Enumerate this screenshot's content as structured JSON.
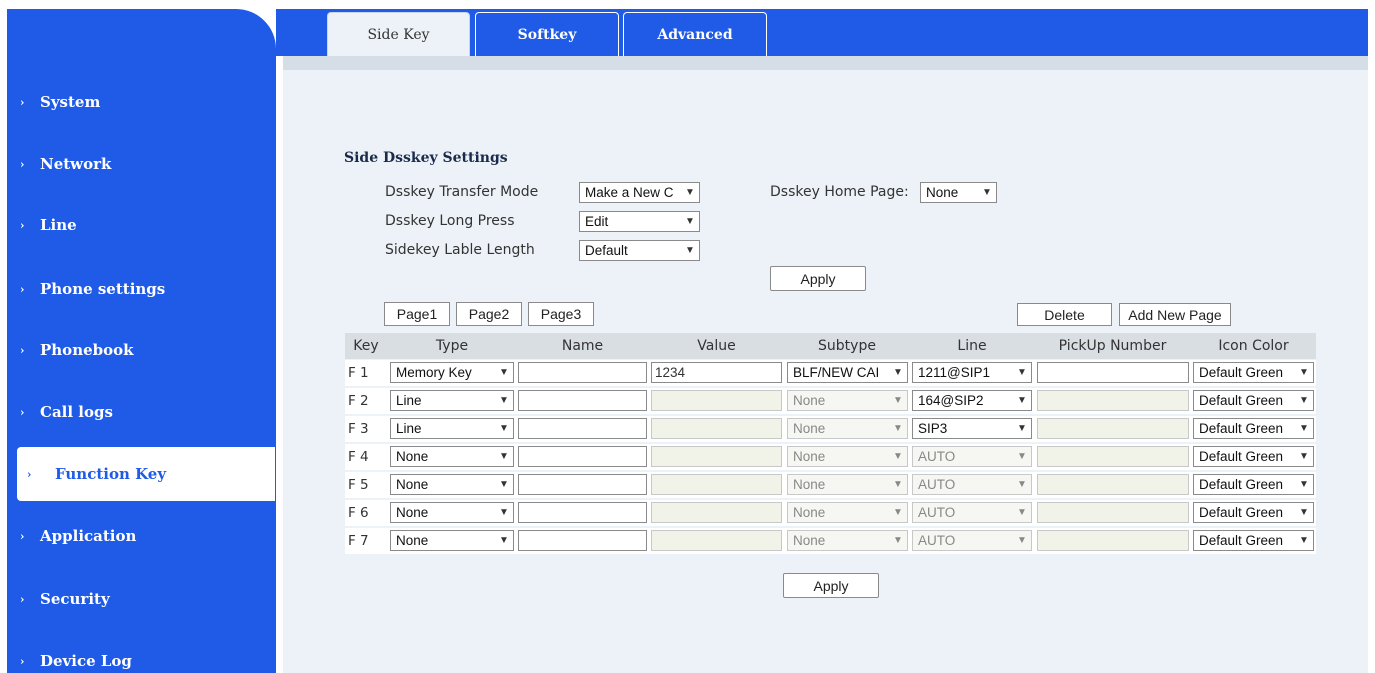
{
  "sidebar": {
    "items": [
      {
        "label": "System"
      },
      {
        "label": "Network"
      },
      {
        "label": "Line"
      },
      {
        "label": "Phone settings"
      },
      {
        "label": "Phonebook"
      },
      {
        "label": "Call logs"
      },
      {
        "label": "Function Key",
        "active": true
      },
      {
        "label": "Application"
      },
      {
        "label": "Security"
      },
      {
        "label": "Device Log"
      }
    ]
  },
  "tabs": [
    {
      "label": "Side Key",
      "active": true
    },
    {
      "label": "Softkey"
    },
    {
      "label": "Advanced"
    }
  ],
  "settings": {
    "title": "Side Dsskey Settings",
    "transfer_mode_label": "Dsskey Transfer Mode",
    "transfer_mode_value": "Make a New C",
    "long_press_label": "Dsskey Long Press",
    "long_press_value": "Edit",
    "lable_length_label": "Sidekey Lable Length",
    "lable_length_value": "Default",
    "home_page_label": "Dsskey Home Page:",
    "home_page_value": "None",
    "apply_label": "Apply"
  },
  "pages": {
    "buttons": [
      "Page1",
      "Page2",
      "Page3"
    ],
    "delete_label": "Delete",
    "add_label": "Add New Page"
  },
  "table": {
    "headers": [
      "Key",
      "Type",
      "Name",
      "Value",
      "Subtype",
      "Line",
      "PickUp Number",
      "Icon Color"
    ],
    "rows": [
      {
        "key": "F 1",
        "type": "Memory Key",
        "name": "",
        "value": "1234",
        "subtype": "BLF/NEW CAI",
        "line": "1211@SIP1",
        "pickup": "",
        "icon_color": "Default Green",
        "disabled": false
      },
      {
        "key": "F 2",
        "type": "Line",
        "name": "",
        "value": "",
        "subtype": "None",
        "line": "164@SIP2",
        "pickup": "",
        "icon_color": "Default Green",
        "disabled": true
      },
      {
        "key": "F 3",
        "type": "Line",
        "name": "",
        "value": "",
        "subtype": "None",
        "line": "SIP3",
        "pickup": "",
        "icon_color": "Default Green",
        "disabled": true
      },
      {
        "key": "F 4",
        "type": "None",
        "name": "",
        "value": "",
        "subtype": "None",
        "line": "AUTO",
        "pickup": "",
        "icon_color": "Default Green",
        "disabled": true
      },
      {
        "key": "F 5",
        "type": "None",
        "name": "",
        "value": "",
        "subtype": "None",
        "line": "AUTO",
        "pickup": "",
        "icon_color": "Default Green",
        "disabled": true
      },
      {
        "key": "F 6",
        "type": "None",
        "name": "",
        "value": "",
        "subtype": "None",
        "line": "AUTO",
        "pickup": "",
        "icon_color": "Default Green",
        "disabled": true
      },
      {
        "key": "F 7",
        "type": "None",
        "name": "",
        "value": "",
        "subtype": "None",
        "line": "AUTO",
        "pickup": "",
        "icon_color": "Default Green",
        "disabled": true
      }
    ],
    "apply_label": "Apply"
  },
  "colors": {
    "brand": "#1f5be6",
    "panel": "#ecf2f7"
  }
}
